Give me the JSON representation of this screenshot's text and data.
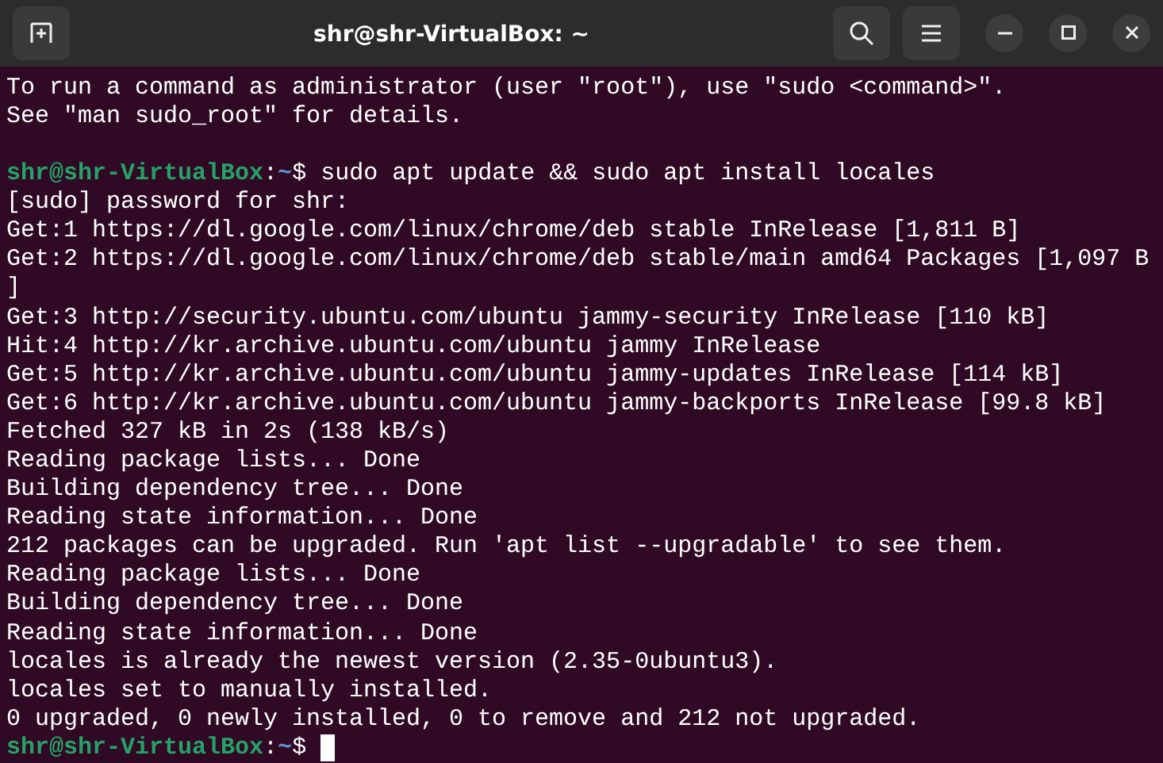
{
  "window": {
    "title": "shr@shr-VirtualBox: ~"
  },
  "terminal": {
    "lines": [
      {
        "kind": "output",
        "text": "To run a command as administrator (user \"root\"), use \"sudo <command>\"."
      },
      {
        "kind": "output",
        "text": "See \"man sudo_root\" for details."
      },
      {
        "kind": "blank"
      },
      {
        "kind": "prompt",
        "user_host": "shr@shr-VirtualBox",
        "separator": ":",
        "path": "~",
        "symbol": "$",
        "command": "sudo apt update && sudo apt install locales",
        "cursor": false
      },
      {
        "kind": "output",
        "text": "[sudo] password for shr:"
      },
      {
        "kind": "output",
        "text": "Get:1 https://dl.google.com/linux/chrome/deb stable InRelease [1,811 B]"
      },
      {
        "kind": "output",
        "text": "Get:2 https://dl.google.com/linux/chrome/deb stable/main amd64 Packages [1,097 B"
      },
      {
        "kind": "output",
        "text": "]"
      },
      {
        "kind": "output",
        "text": "Get:3 http://security.ubuntu.com/ubuntu jammy-security InRelease [110 kB]"
      },
      {
        "kind": "output",
        "text": "Hit:4 http://kr.archive.ubuntu.com/ubuntu jammy InRelease"
      },
      {
        "kind": "output",
        "text": "Get:5 http://kr.archive.ubuntu.com/ubuntu jammy-updates InRelease [114 kB]"
      },
      {
        "kind": "output",
        "text": "Get:6 http://kr.archive.ubuntu.com/ubuntu jammy-backports InRelease [99.8 kB]"
      },
      {
        "kind": "output",
        "text": "Fetched 327 kB in 2s (138 kB/s)"
      },
      {
        "kind": "output",
        "text": "Reading package lists... Done"
      },
      {
        "kind": "output",
        "text": "Building dependency tree... Done"
      },
      {
        "kind": "output",
        "text": "Reading state information... Done"
      },
      {
        "kind": "output",
        "text": "212 packages can be upgraded. Run 'apt list --upgradable' to see them."
      },
      {
        "kind": "output",
        "text": "Reading package lists... Done"
      },
      {
        "kind": "output",
        "text": "Building dependency tree... Done"
      },
      {
        "kind": "output",
        "text": "Reading state information... Done"
      },
      {
        "kind": "output",
        "text": "locales is already the newest version (2.35-0ubuntu3)."
      },
      {
        "kind": "output",
        "text": "locales set to manually installed."
      },
      {
        "kind": "output",
        "text": "0 upgraded, 0 newly installed, 0 to remove and 212 not upgraded."
      },
      {
        "kind": "prompt",
        "user_host": "shr@shr-VirtualBox",
        "separator": ":",
        "path": "~",
        "symbol": "$",
        "cursor": true
      }
    ]
  }
}
